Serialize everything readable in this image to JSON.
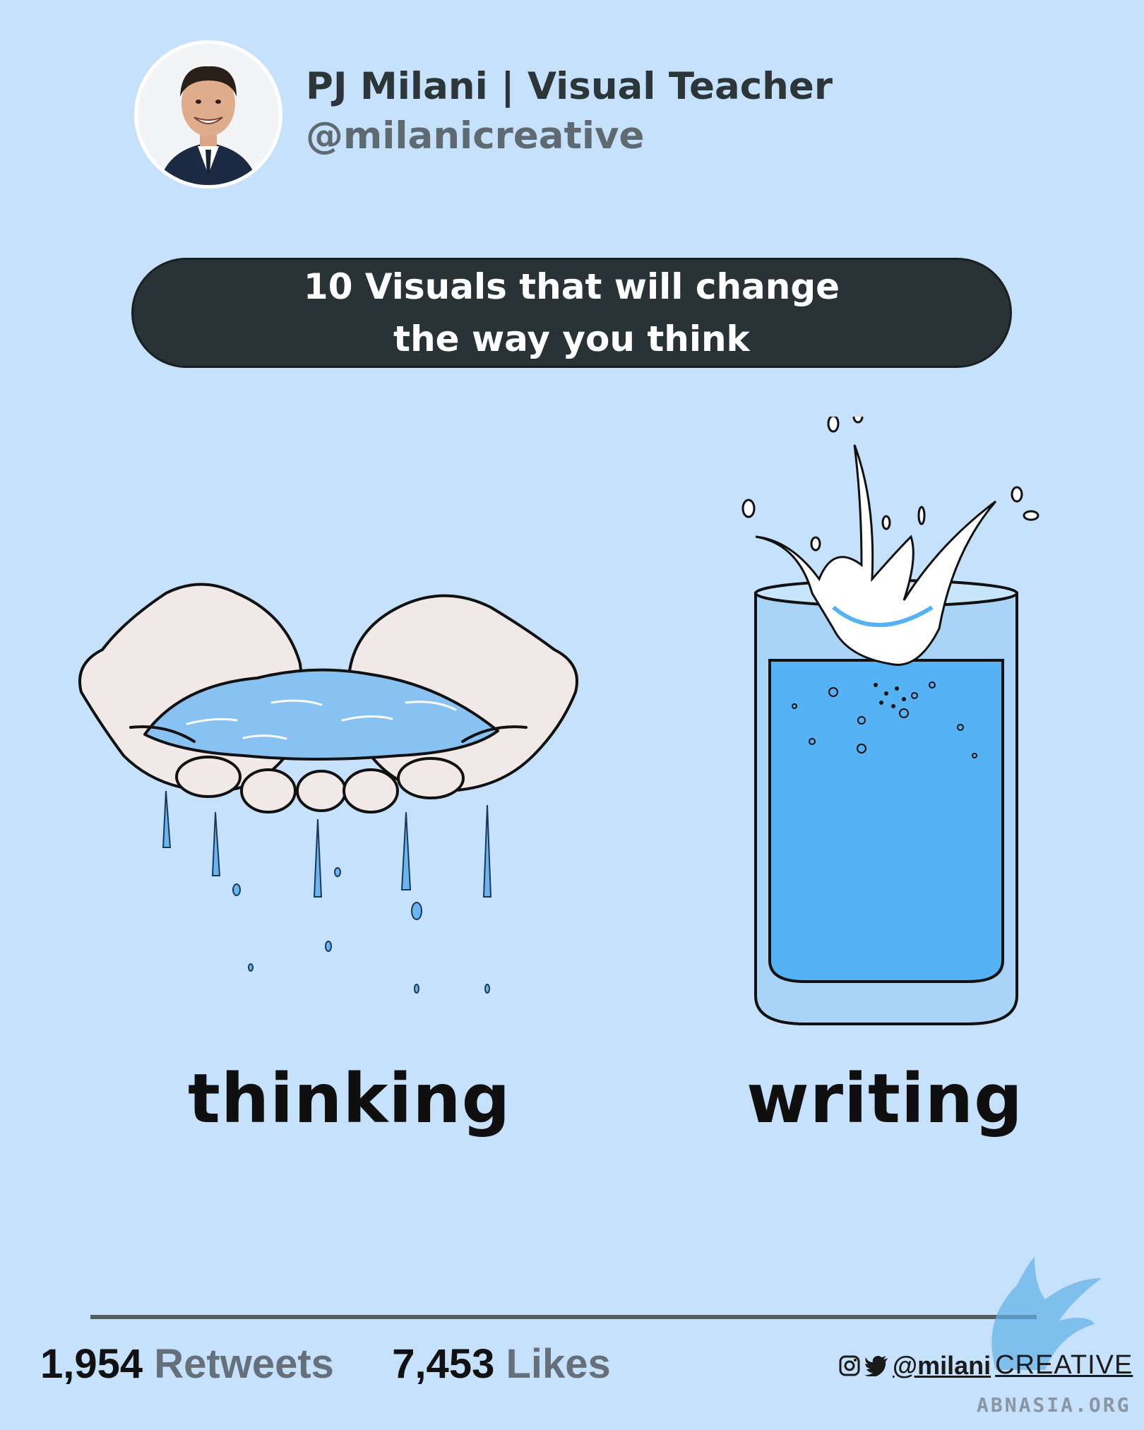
{
  "author": {
    "name": "PJ Milani | Visual Teacher",
    "handle": "@milanicreative"
  },
  "title": {
    "line1": "10 Visuals that will change",
    "line2": "the way you think"
  },
  "panels": {
    "left_caption": "thinking",
    "right_caption": "writing"
  },
  "stats": {
    "retweets_count": "1,954",
    "retweets_label": "Retweets",
    "likes_count": "7,453",
    "likes_label": "Likes"
  },
  "social": {
    "handle": "@milani",
    "brand": "CREATIVE"
  },
  "watermark": {
    "text": "ABNASIA.ORG"
  },
  "colors": {
    "background": "#c6e1fb",
    "pill": "#293335",
    "water": "#55b3f5"
  }
}
